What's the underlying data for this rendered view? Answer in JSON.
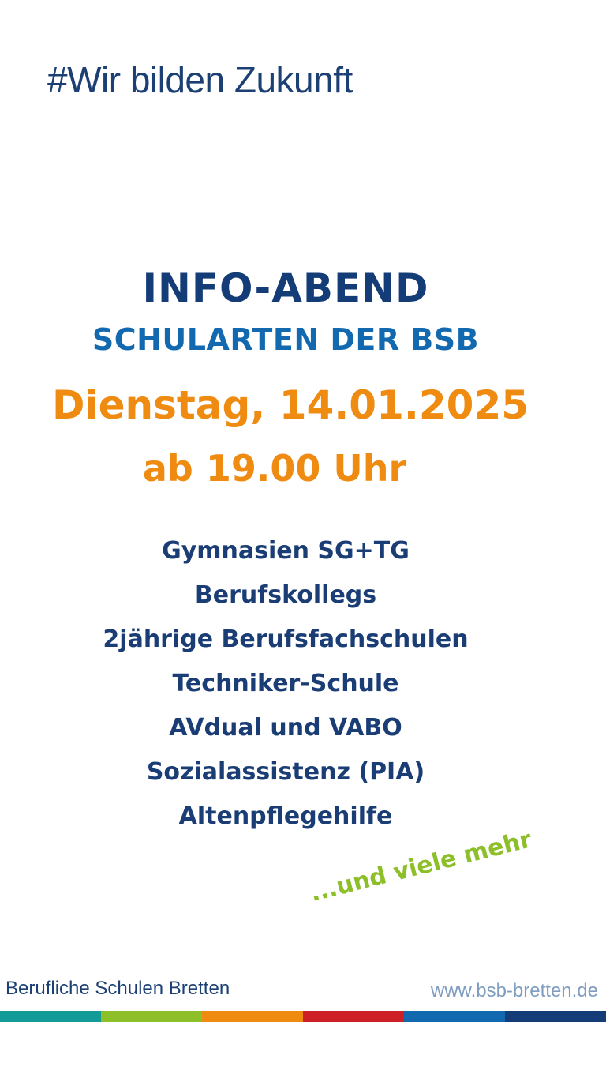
{
  "hashtag": "#Wir bilden Zukunft",
  "event": {
    "title": "INFO-ABEND",
    "subtitle": "SCHULARTEN DER BSB",
    "date": "Dienstag, 14.01.2025",
    "time": "ab 19.00 Uhr"
  },
  "programs": [
    "Gymnasien SG+TG",
    "Berufskollegs",
    "2jährige Berufsfachschulen",
    "Techniker-Schule",
    "AVdual und VABO",
    "Sozialassistenz (PIA)",
    "Altenpflegehilfe"
  ],
  "more_text": "...und viele mehr",
  "footer": {
    "school_name": "Berufliche Schulen Bretten",
    "url": "www.bsb-bretten.de"
  },
  "colors": {
    "navy": "#143c76",
    "blue": "#1269b0",
    "orange": "#ef8b10",
    "green": "#8dbf29",
    "stripe": [
      "#139c97",
      "#8dbf29",
      "#ef8b10",
      "#cc1f26",
      "#1269b0",
      "#143c76"
    ]
  }
}
